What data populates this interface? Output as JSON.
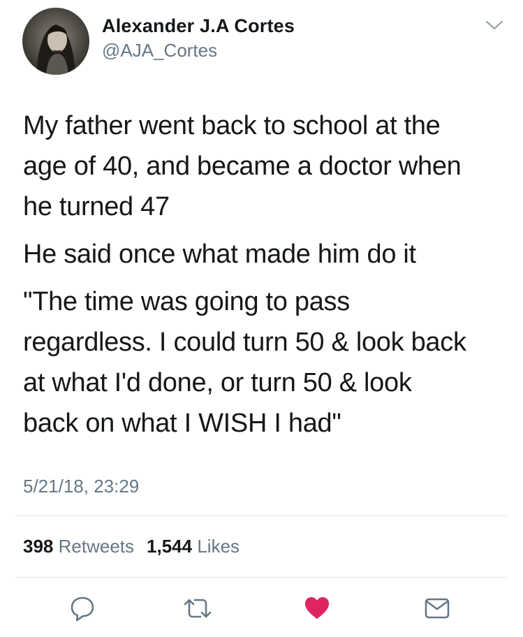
{
  "user": {
    "display_name": "Alexander J.A Cortes",
    "handle": "@AJA_Cortes"
  },
  "tweet": {
    "paragraphs": [
      "My father went back to school at the\nage of 40, and became a doctor when\nhe turned 47",
      "He said once what made him do it",
      "\"The time was going to pass\nregardless. I could turn 50 & look back\nat what I'd done, or turn 50 & look\nback on what I WISH I had\""
    ],
    "timestamp": "5/21/18, 23:29"
  },
  "stats": {
    "retweets_count": "398",
    "retweets_label": "Retweets",
    "likes_count": "1,544",
    "likes_label": "Likes"
  },
  "actions": {
    "reply_icon": "reply-icon",
    "retweet_icon": "retweet-icon",
    "like_icon": "heart-icon",
    "share_icon": "mail-icon"
  },
  "colors": {
    "text": "#14171a",
    "secondary": "#657786",
    "divider": "#e1e8ed",
    "icon": "#657786",
    "like": "#e0245e"
  }
}
